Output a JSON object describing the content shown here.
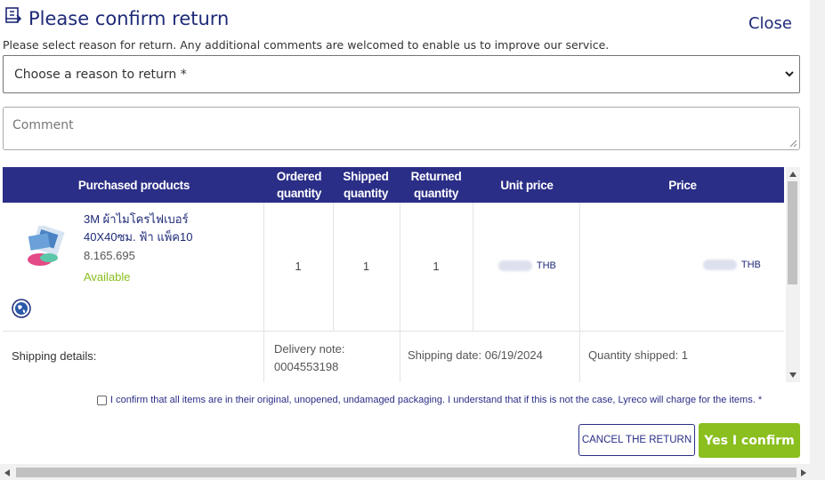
{
  "dialog": {
    "title": "Please confirm return",
    "close_label": "Close",
    "subtitle": "Please select reason for return. Any additional comments are welcomed to enable us to improve our service."
  },
  "form": {
    "reason_selected": "Choose a reason to return *",
    "comment_placeholder": "Comment"
  },
  "table": {
    "headers": {
      "purchased_products": "Purchased products",
      "ordered_quantity": "Ordered quantity",
      "shipped_quantity": "Shipped quantity",
      "returned_quantity": "Returned quantity",
      "unit_price": "Unit price",
      "price": "Price"
    },
    "row": {
      "product_name": "3M ผ้าไมโครไฟเบอร์ 40X40ซม. ฟ้า แพ็ค10",
      "product_code": "8.165.695",
      "availability": "Available",
      "ordered_quantity": "1",
      "shipped_quantity": "1",
      "returned_quantity": "1",
      "unit_price_currency": "THB",
      "price_currency": "THB"
    },
    "shipping": {
      "label": "Shipping details:",
      "delivery_note": "Delivery note:\n0004553198",
      "shipping_date": "Shipping date: 06/19/2024",
      "quantity_shipped": "Quantity shipped: 1"
    }
  },
  "confirmation_text": "I confirm that all items are in their original, unopened, undamaged packaging. I understand that if this is not the case, Lyreco will charge for the items. *",
  "buttons": {
    "cancel": "CANCEL THE RETURN",
    "confirm": "Yes I confirm"
  },
  "colors": {
    "primary": "#2a2e86",
    "accent_green": "#8abf1f"
  }
}
